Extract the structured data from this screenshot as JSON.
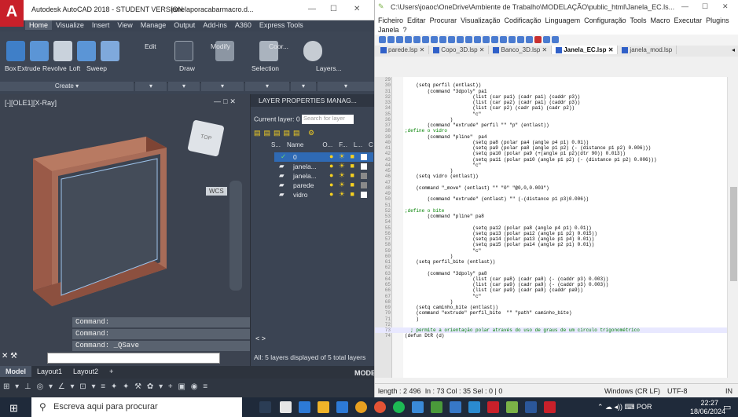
{
  "acad": {
    "title": "Autodesk AutoCAD 2018 - STUDENT VERSION",
    "file": "janelaporacabarmacro.d...",
    "ribbon_tabs": [
      "Home",
      "Visualize",
      "Insert",
      "View",
      "Manage",
      "Output",
      "Add-ins",
      "A360",
      "Express Tools"
    ],
    "ribbon_tools": [
      "Box",
      "Extrude",
      "Revolve",
      "Loft",
      "Sweep",
      "Edit",
      "Draw",
      "Modify",
      "Selection",
      "Coor...",
      "Layers..."
    ],
    "panel_create": "Create",
    "viewport_label": "[-][OLE1][X-Ray]",
    "wcs": "WCS",
    "command_history": [
      "Command:",
      "Command:",
      "Command:  _QSave"
    ],
    "layout_tabs": [
      "Model",
      "Layout1",
      "Layout2",
      "+"
    ],
    "model_label": "MODEL"
  },
  "layers": {
    "title": "LAYER PROPERTIES MANAG...",
    "current_label": "Current layer: 0",
    "search_placeholder": "Search for layer",
    "headers": [
      "S...",
      "Name",
      "O...",
      "F...",
      "L...",
      "C"
    ],
    "rows": [
      {
        "name": "0",
        "color": "#ffffff",
        "selected": true
      },
      {
        "name": "janela...",
        "color": "#ffffff",
        "selected": false
      },
      {
        "name": "janela...",
        "color": "#8a8a8a",
        "selected": false
      },
      {
        "name": "parede",
        "color": "#8a8a8a",
        "selected": false
      },
      {
        "name": "vidro",
        "color": "#ffffff",
        "selected": false
      }
    ],
    "summary": "All: 5 layers displayed of 5 total layers"
  },
  "npp": {
    "title": "C:\\Users\\joaoc\\OneDrive\\Ambiente de Trabalho\\MODELAÇÃO\\public_html\\Janela_EC.ls...",
    "menu": [
      "Ficheiro",
      "Editar",
      "Procurar",
      "Visualização",
      "Codificação",
      "Linguagem",
      "Configuração",
      "Tools",
      "Macro",
      "Executar",
      "Plugins",
      "Janela",
      "?"
    ],
    "tabs": [
      "parede.lsp",
      "Copo_3D.lsp",
      "Banco_3D.lsp",
      "Janela_EC.lsp",
      "janela_mod.lsp"
    ],
    "lines": [
      {
        "n": "29",
        "t": ""
      },
      {
        "n": "30",
        "t": "    (setq perfil (entlast))"
      },
      {
        "n": "31",
        "t": "        (command \"3dpoly\" pa1"
      },
      {
        "n": "32",
        "t": "                        (list (car pa1) (cadr pa1) (caddr p3))"
      },
      {
        "n": "33",
        "t": "                        (list (car pa2) (cadr pa1) (caddr p3))"
      },
      {
        "n": "34",
        "t": "                        (list (car p2) (cadr pa1) (cadr p2))"
      },
      {
        "n": "35",
        "t": "                        \"c\""
      },
      {
        "n": "36",
        "t": "                )"
      },
      {
        "n": "37",
        "t": "        (command \"extrude\" perfil \"\" \"p\" (entlast))"
      },
      {
        "n": "38",
        "t": ";define o vidro"
      },
      {
        "n": "39",
        "t": "        (command \"pline\"  pa4"
      },
      {
        "n": "40",
        "t": "                        (setq pa8 (polar pa4 (angle p4 p1) 0.01))"
      },
      {
        "n": "41",
        "t": "                        (setq pa9 (polar pa8 (angle p1 p2) (- (distance p1 p2) 0.006)))"
      },
      {
        "n": "42",
        "t": "                        (setq pa10 (polar pa9 (+(angle p1 p2)(dtr 90)) 0.013))"
      },
      {
        "n": "43",
        "t": "                        (setq pa11 (polar pa10 (angle p1 p2) (- (distance p1 p2) 0.006)))"
      },
      {
        "n": "44",
        "t": "                        \"c\""
      },
      {
        "n": "45",
        "t": "                )"
      },
      {
        "n": "46",
        "t": "    (setq vidro (entlast))"
      },
      {
        "n": "47",
        "t": ""
      },
      {
        "n": "48",
        "t": "    (command \"_move\" (entlast) \"\" \"0\" \"@0,0,0.003\")"
      },
      {
        "n": "49",
        "t": ""
      },
      {
        "n": "50",
        "t": "        (command \"extrude\" (entlast) \"\" (-(distance p1 p3)0.006))"
      },
      {
        "n": "51",
        "t": ""
      },
      {
        "n": "52",
        "t": ";define o bite"
      },
      {
        "n": "53",
        "t": "        (command \"pline\" pa8"
      },
      {
        "n": "54",
        "t": ""
      },
      {
        "n": "55",
        "t": "                        (setq pa12 (polar pa8 (angle p4 p1) 0.01))"
      },
      {
        "n": "56",
        "t": "                        (setq pa13 (polar pa12 (angle p1 p2) 0.015))"
      },
      {
        "n": "57",
        "t": "                        (setq pa14 (polar pa13 (angle p1 p4) 0.01))"
      },
      {
        "n": "58",
        "t": "                        (setq pa15 (polar pa14 (angle p2 p1) 0.01))"
      },
      {
        "n": "59",
        "t": "                        \"c\""
      },
      {
        "n": "60",
        "t": "                )"
      },
      {
        "n": "61",
        "t": "    (setq perfil_bite (entlast))"
      },
      {
        "n": "62",
        "t": ""
      },
      {
        "n": "63",
        "t": "        (command \"3dpoly\" pa8"
      },
      {
        "n": "64",
        "t": "                        (list (car pa8) (cadr pa8) (- (caddr p3) 0.003))"
      },
      {
        "n": "65",
        "t": "                        (list (car pa9) (cadr pa9) (- (caddr p3) 0.003))"
      },
      {
        "n": "66",
        "t": "                        (list (car pa9) (cadr pa9) (caddr pa9))"
      },
      {
        "n": "67",
        "t": "                        \"c\""
      },
      {
        "n": "68",
        "t": "                )"
      },
      {
        "n": "69",
        "t": "    (setq caminho_bite (entlast))"
      },
      {
        "n": "70",
        "t": "    (command \"extrude\" perfil_bite  \"\" \"path\" caminho_bite)"
      },
      {
        "n": "71",
        "t": "    )"
      },
      {
        "n": "72",
        "t": ""
      },
      {
        "n": "73",
        "t": "  ; permite a orientação polar através do uso de graus de um círculo trigonométrico"
      },
      {
        "n": "74",
        "t": "(defun DtR (d)"
      }
    ],
    "status": {
      "length": "length : 2 496",
      "position": "ln : 73    Col : 35    Sel : 0 | 0",
      "eol": "Windows (CR LF)",
      "encoding": "UTF-8",
      "mode": "IN"
    }
  },
  "taskbar": {
    "search_placeholder": "Escreva aqui para procurar",
    "lang": "POR",
    "time": "22:27",
    "date": "18/06/2024"
  }
}
